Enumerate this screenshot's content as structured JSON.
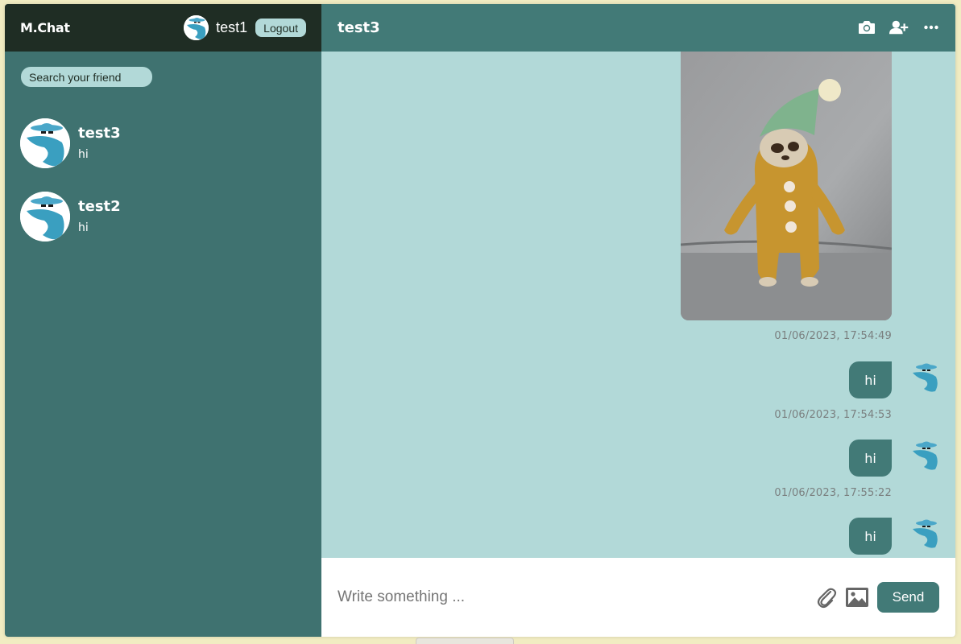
{
  "app": {
    "logo": "M.Chat"
  },
  "current_user": {
    "name": "test1",
    "logout_label": "Logout"
  },
  "search": {
    "placeholder": "Search your friend"
  },
  "chats": [
    {
      "name": "test3",
      "last_message": "hi"
    },
    {
      "name": "test2",
      "last_message": "hi"
    }
  ],
  "conversation": {
    "title": "test3",
    "header_icons": [
      "camera-icon",
      "add-user-icon",
      "more-icon"
    ],
    "messages": [
      {
        "type": "image",
        "timestamp": "01/06/2023, 17:54:49",
        "alt": "crochet sloth toy wearing green hat"
      },
      {
        "type": "text",
        "text": "hi",
        "timestamp": "01/06/2023, 17:54:53"
      },
      {
        "type": "text",
        "text": "hi",
        "timestamp": "01/06/2023, 17:55:22"
      },
      {
        "type": "text",
        "text": "hi"
      }
    ]
  },
  "composer": {
    "placeholder": "Write something ...",
    "send_label": "Send"
  },
  "colors": {
    "sidebar": "#3f7270",
    "sidebar_header": "#1f2d24",
    "main_header": "#427a77",
    "chat_bg": "#b2d9d8",
    "accent": "#427a77"
  }
}
